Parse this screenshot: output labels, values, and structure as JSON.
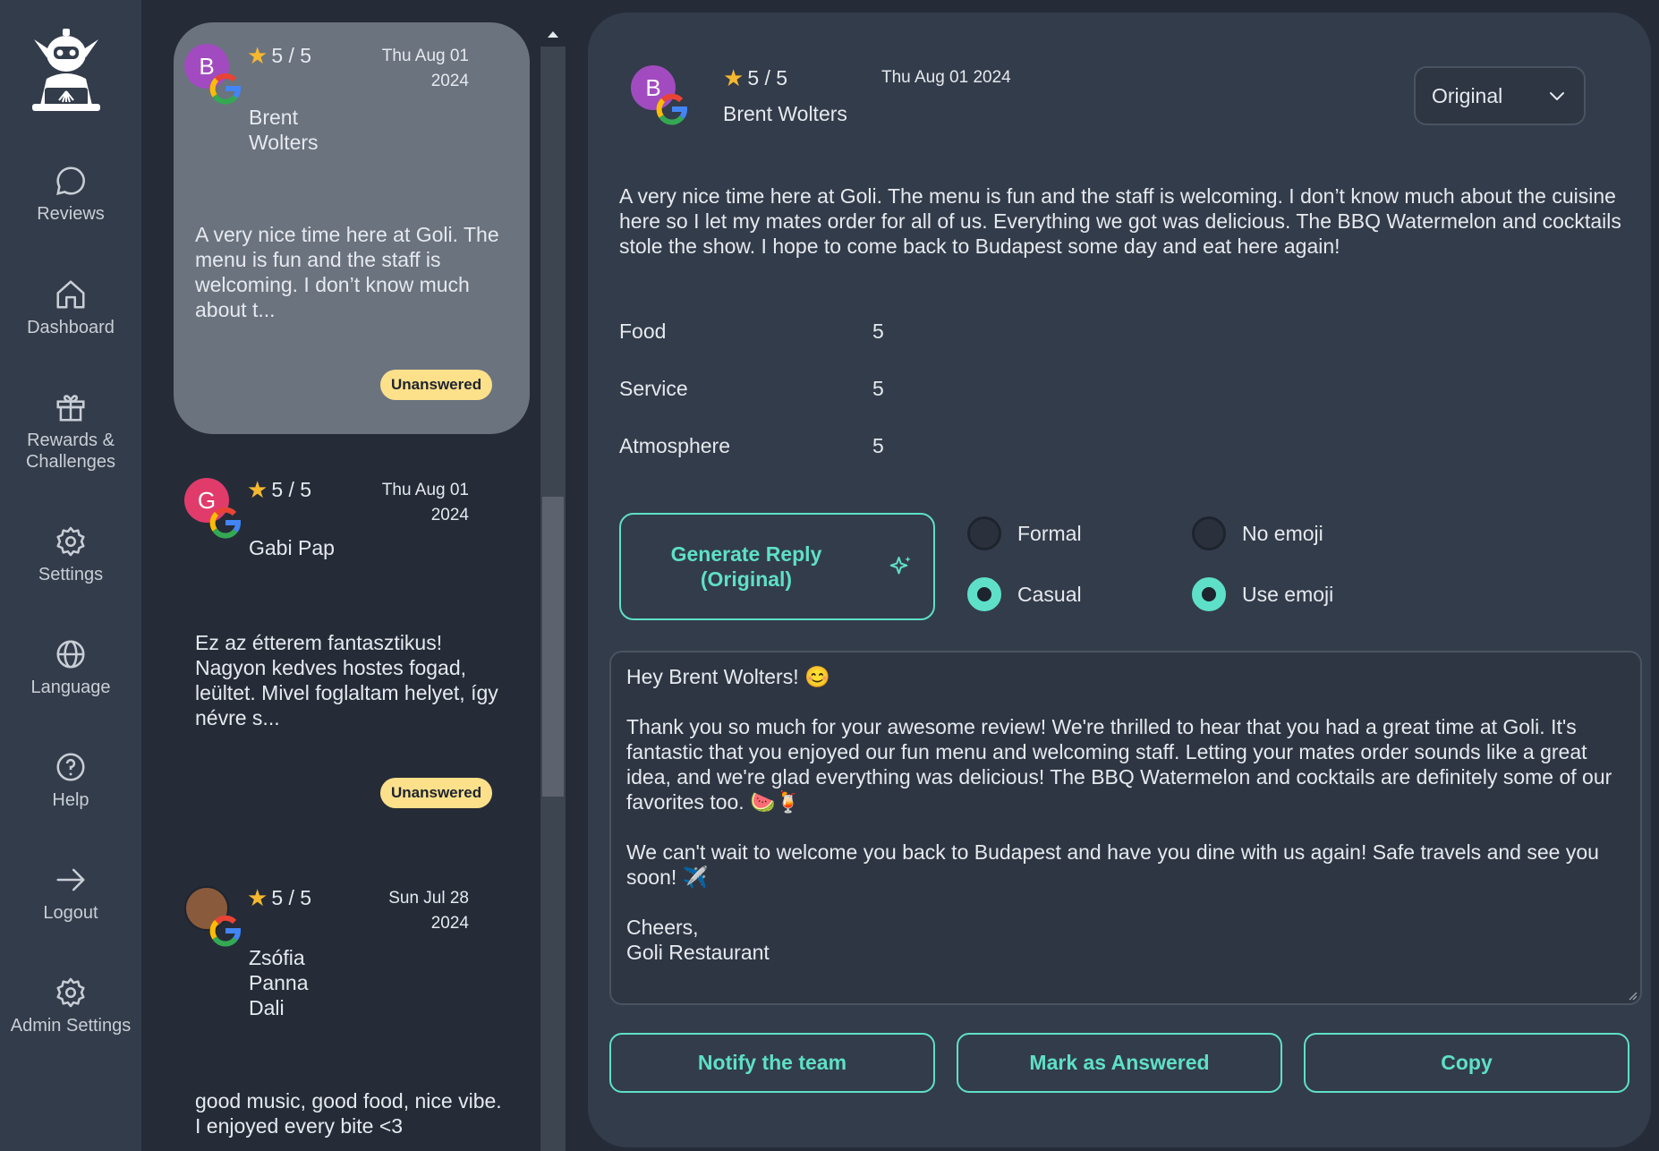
{
  "sidebar": {
    "items": [
      {
        "label": "Reviews",
        "icon": "chat-bubble-icon"
      },
      {
        "label": "Dashboard",
        "icon": "home-icon"
      },
      {
        "label": "Rewards & Challenges",
        "icon": "gift-icon"
      },
      {
        "label": "Settings",
        "icon": "gear-icon"
      },
      {
        "label": "Language",
        "icon": "globe-icon"
      },
      {
        "label": "Help",
        "icon": "help-circle-icon"
      },
      {
        "label": "Logout",
        "icon": "arrow-right-icon"
      },
      {
        "label": "Admin Settings",
        "icon": "gear-icon"
      }
    ]
  },
  "reviews": [
    {
      "initial": "B",
      "avatar_color": "#a24bc0",
      "rating": "5 / 5",
      "date_line1": "Thu Aug 01",
      "date_line2": "2024",
      "name_lines": [
        "Brent",
        "Wolters"
      ],
      "snippet": "A very nice time here at Goli. The menu is fun and the staff is welcoming. I don’t know much about t...",
      "status": "Unanswered"
    },
    {
      "initial": "G",
      "avatar_color": "#e03b6b",
      "rating": "5 / 5",
      "date_line1": "Thu Aug 01",
      "date_line2": "2024",
      "name_lines": [
        "Gabi Pap"
      ],
      "snippet": "Ez az étterem fantasztikus! Nagyon kedves hostes fogad, leültet. Mivel foglaltam helyet, így névre s...",
      "status": "Unanswered"
    },
    {
      "initial": "",
      "avatar_color": "#8a5a3c",
      "rating": "5 / 5",
      "date_line1": "Sun Jul 28",
      "date_line2": "2024",
      "name_lines": [
        "Zsófia",
        "Panna",
        "Dali"
      ],
      "snippet": "good music, good food, nice vibe. I enjoyed every bite <3",
      "status": ""
    }
  ],
  "detail": {
    "initial": "B",
    "rating": "5 / 5",
    "date": "Thu Aug 01 2024",
    "name": "Brent Wolters",
    "language_select": "Original",
    "text": "A very nice time here at Goli. The menu is fun and the staff is welcoming. I don’t know much about the cuisine here so I let my mates order for all of us. Everything we got was delicious. The BBQ Watermelon and cocktails stole the show. I hope to come back to Budapest some day and eat here again!",
    "categories": [
      {
        "name": "Food",
        "value": "5"
      },
      {
        "name": "Service",
        "value": "5"
      },
      {
        "name": "Atmosphere",
        "value": "5"
      }
    ]
  },
  "generate": {
    "label_line1": "Generate Reply",
    "label_line2": "(Original)"
  },
  "tone_options": [
    {
      "label": "Formal",
      "selected": false
    },
    {
      "label": "Casual",
      "selected": true
    }
  ],
  "emoji_options": [
    {
      "label": "No emoji",
      "selected": false
    },
    {
      "label": "Use emoji",
      "selected": true
    }
  ],
  "reply": {
    "greeting": "Hey Brent Wolters! 😊",
    "para1": "Thank you so much for your awesome review! We're thrilled to hear that you had a great time at Goli. It's fantastic that you enjoyed our fun menu and welcoming staff. Letting your mates order sounds like a great idea, and we're glad everything was delicious! The BBQ Watermelon and cocktails are definitely some of our favorites too. 🍉🍹",
    "para2": "We can't wait to welcome you back to Budapest and have you dine with us again! Safe travels and see you soon! ✈️",
    "signoff1": "Cheers,",
    "signoff2": "Goli Restaurant"
  },
  "actions": {
    "notify": "Notify the team",
    "mark_answered": "Mark as Answered",
    "copy": "Copy"
  },
  "colors": {
    "accent": "#5ee0c8",
    "badge": "#fde08a",
    "star": "#f5b82e"
  }
}
